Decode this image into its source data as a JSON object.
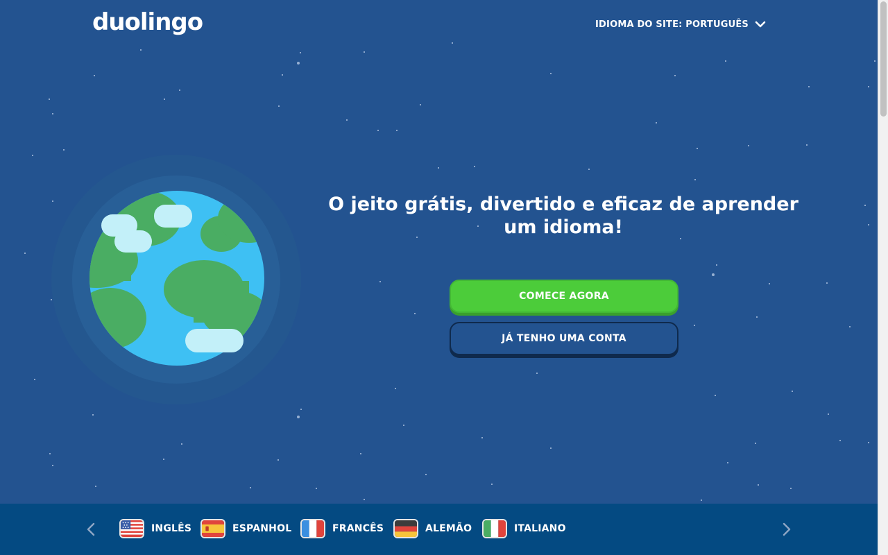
{
  "header": {
    "logo_text": "duolingo",
    "site_language_label": "IDIOMA DO SITE: PORTUGUÊS"
  },
  "hero": {
    "headline": "O jeito grátis, divertido e eficaz de aprender um idioma!",
    "primary_button": "COMECE AGORA",
    "secondary_button": "JÁ TENHO UMA CONTA"
  },
  "language_bar": {
    "languages": [
      {
        "label": "INGLÊS",
        "flag": "us-flag"
      },
      {
        "label": "ESPANHOL",
        "flag": "spain-flag"
      },
      {
        "label": "FRANCÊS",
        "flag": "france-flag"
      },
      {
        "label": "ALEMÃO",
        "flag": "germany-flag"
      },
      {
        "label": "ITALIANO",
        "flag": "italy-flag"
      }
    ]
  },
  "colors": {
    "background": "#235390",
    "language_bar": "#044a82",
    "primary_button": "#4ccc3a",
    "ocean": "#3ec0f3",
    "land": "#4aad63",
    "cloud": "#c3f0f9"
  }
}
